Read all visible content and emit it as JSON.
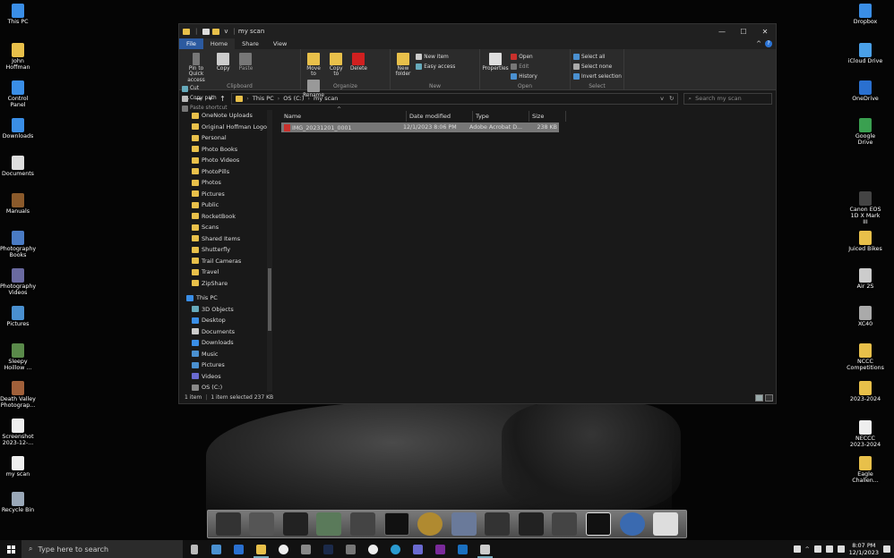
{
  "desktop_left": [
    {
      "label": "This PC",
      "color": "#3a8ee6"
    },
    {
      "label": "John Hoffman",
      "color": "#e8c04a"
    },
    {
      "label": "Control Panel",
      "color": "#3a8ee6"
    },
    {
      "label": "Downloads",
      "color": "#3a8ee6"
    },
    {
      "label": "Documents",
      "color": "#dddddd"
    },
    {
      "label": "Manuals",
      "color": "#8b5a2b"
    },
    {
      "label": "Photography Books",
      "color": "#4a7bc4"
    },
    {
      "label": "Photography Videos",
      "color": "#6a6aa0"
    },
    {
      "label": "Pictures",
      "color": "#4a90d0"
    },
    {
      "label": "Sleepy Hoillow ...",
      "color": "#5a8a4a"
    },
    {
      "label": "Death Valley Photograp...",
      "color": "#a0603a"
    },
    {
      "label": "Screenshot 2023-12-...",
      "color": "#eeeeee"
    },
    {
      "label": "my scan",
      "color": "#eeeeee"
    },
    {
      "label": "Recycle Bin",
      "color": "#9aa8b8"
    }
  ],
  "desktop_right": [
    {
      "label": "Dropbox",
      "color": "#3a8ee6"
    },
    {
      "label": "iCloud Drive",
      "color": "#4aa0e8"
    },
    {
      "label": "OneDrive",
      "color": "#2a70d0"
    },
    {
      "label": "Google Drive",
      "color": "#3aa050"
    },
    {
      "label": "Canon EOS 1D X Mark III",
      "color": "#444444"
    },
    {
      "label": "Juiced Bikes",
      "color": "#e8c04a"
    },
    {
      "label": "Air 2S",
      "color": "#cccccc"
    },
    {
      "label": "XC40",
      "color": "#aaaaaa"
    },
    {
      "label": "NCCC Competitions",
      "color": "#e8c04a"
    },
    {
      "label": "2023-2024",
      "color": "#e8c04a"
    },
    {
      "label": "NECCC 2023-2024",
      "color": "#eeeeee"
    },
    {
      "label": "Eagle Challen...",
      "color": "#e8c04a"
    }
  ],
  "window": {
    "title": "my scan",
    "controls": {
      "minimize": "—",
      "maximize": "☐",
      "close": "✕"
    },
    "qa_sep": "|",
    "qa_arrow": "v"
  },
  "tabs": {
    "file": "File",
    "home": "Home",
    "share": "Share",
    "view": "View",
    "expand": "^",
    "help": "?"
  },
  "ribbon": {
    "clipboard": {
      "title": "Clipboard",
      "pin": "Pin to Quick access",
      "copy": "Copy",
      "paste": "Paste",
      "cut": "Cut",
      "copy_path": "Copy path",
      "paste_shortcut": "Paste shortcut"
    },
    "organize": {
      "title": "Organize",
      "move_to": "Move to",
      "copy_to": "Copy to",
      "delete": "Delete",
      "rename": "Rename"
    },
    "new": {
      "title": "New",
      "new_folder": "New folder",
      "new_item": "New item",
      "easy_access": "Easy access"
    },
    "open": {
      "title": "Open",
      "properties": "Properties",
      "open": "Open",
      "edit": "Edit",
      "history": "History"
    },
    "select": {
      "title": "Select",
      "select_all": "Select all",
      "select_none": "Select none",
      "invert": "Invert selection"
    }
  },
  "address": {
    "back": "←",
    "forward": "→",
    "recent": "v",
    "up": "↑",
    "crumbs": [
      "This PC",
      "OS (C:)",
      "my scan"
    ],
    "crumb_sep": "›",
    "dropdown": "v",
    "refresh": "↻",
    "search_placeholder": "Search my scan"
  },
  "nav": {
    "folders": [
      "OneNote Uploads",
      "Original Hoffman Logos",
      "Personal",
      "Photo Books",
      "Photo Videos",
      "PhotoPills",
      "Photos",
      "Pictures",
      "Public",
      "RocketBook",
      "Scans",
      "Shared Items",
      "Shutterfly",
      "Trail Cameras",
      "Travel",
      "ZipShare"
    ],
    "this_pc": "This PC",
    "pc_items": [
      "3D Objects",
      "Desktop",
      "Documents",
      "Downloads",
      "Music",
      "Pictures",
      "Videos",
      "OS (C:)"
    ]
  },
  "columns": {
    "name": "Name",
    "date": "Date modified",
    "type": "Type",
    "size": "Size",
    "sort_indicator": "^"
  },
  "files": [
    {
      "name": "IMG_20231201_0001",
      "date": "12/1/2023 8:06 PM",
      "type": "Adobe Acrobat D...",
      "size": "238 KB"
    }
  ],
  "status": {
    "count": "1 item",
    "selected": "1 item selected  237 KB"
  },
  "taskbar": {
    "search_placeholder": "Type here to search",
    "time": "8:07 PM",
    "date": "12/1/2023"
  }
}
